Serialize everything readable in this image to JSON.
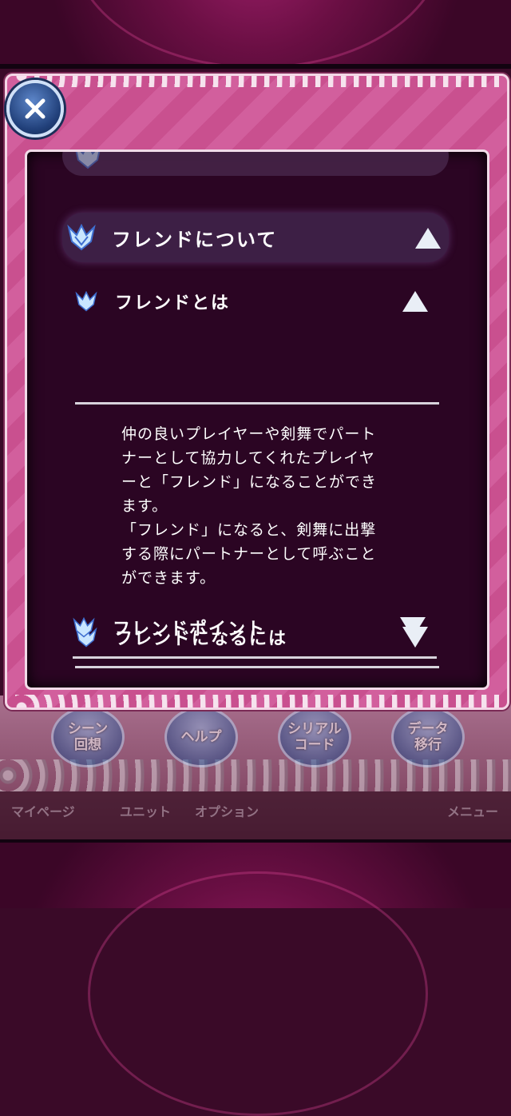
{
  "dialog": {
    "section_title": "フレンドについて",
    "items": [
      {
        "title": "フレンドとは",
        "expanded": true
      },
      {
        "title": "フレンドになるには",
        "expanded": false
      },
      {
        "title": "フレンドポイント",
        "expanded": false
      }
    ],
    "body_lines": [
      "仲の良いプレイヤーや剣舞でパート",
      "ナーとして協力してくれたプレイヤ",
      "ーと「フレンド」になることができ",
      "ます。",
      "「フレンド」になると、剣舞に出撃",
      "する際にパートナーとして呼ぶこと",
      "ができます。"
    ]
  },
  "underlay": {
    "buttons": [
      "シーン回想",
      "ヘルプ",
      "シリアルコード",
      "データ移行"
    ],
    "button_lines": [
      [
        "シーン",
        "回想"
      ],
      [
        "ヘルプ"
      ],
      [
        "シリアル",
        "コード"
      ],
      [
        "データ",
        "移行"
      ]
    ],
    "bar_labels": [
      "マイページ",
      "ユニット",
      "オプション",
      "メニュー"
    ]
  },
  "icons": {
    "close": "close-icon",
    "crest": "crest-icon",
    "expand_up": "triangle-up-icon",
    "expand_down": "triangle-down-icon"
  },
  "colors": {
    "panel": "#2b0523",
    "frame": "#d25f9d",
    "header": "#3d1f45"
  }
}
